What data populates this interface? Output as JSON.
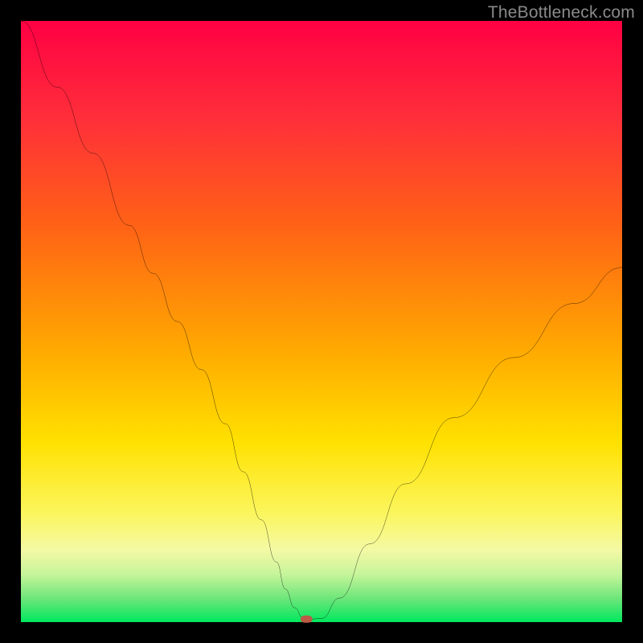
{
  "watermark": "TheBottleneck.com",
  "chart_data": {
    "type": "line",
    "title": "",
    "xlabel": "",
    "ylabel": "",
    "xlim": [
      0,
      100
    ],
    "ylim": [
      0,
      100
    ],
    "series": [
      {
        "name": "bottleneck-curve",
        "x": [
          0,
          6,
          12,
          18,
          22,
          26,
          30,
          34,
          37,
          40,
          42.5,
          44,
          45.5,
          47,
          48,
          50,
          53,
          58,
          64,
          72,
          82,
          92,
          100
        ],
        "y": [
          100,
          89,
          78,
          66,
          58,
          50,
          42,
          33,
          25,
          17,
          10,
          5.5,
          2.4,
          0.6,
          0.5,
          0.6,
          4,
          13,
          23,
          34,
          44,
          53,
          59
        ]
      }
    ],
    "marker": {
      "x": 47.5,
      "y": 0.5,
      "shape": "rounded-rect",
      "color": "#bc5a46"
    },
    "gradient_stops": [
      {
        "pos": 0,
        "color": "#ff0043"
      },
      {
        "pos": 16,
        "color": "#ff2e3a"
      },
      {
        "pos": 34,
        "color": "#ff6216"
      },
      {
        "pos": 55,
        "color": "#ffaa00"
      },
      {
        "pos": 70,
        "color": "#ffe100"
      },
      {
        "pos": 82,
        "color": "#fbf65e"
      },
      {
        "pos": 88,
        "color": "#f4f9a5"
      },
      {
        "pos": 92,
        "color": "#c7f59b"
      },
      {
        "pos": 96,
        "color": "#6fe67a"
      },
      {
        "pos": 100,
        "color": "#00e85e"
      }
    ]
  }
}
